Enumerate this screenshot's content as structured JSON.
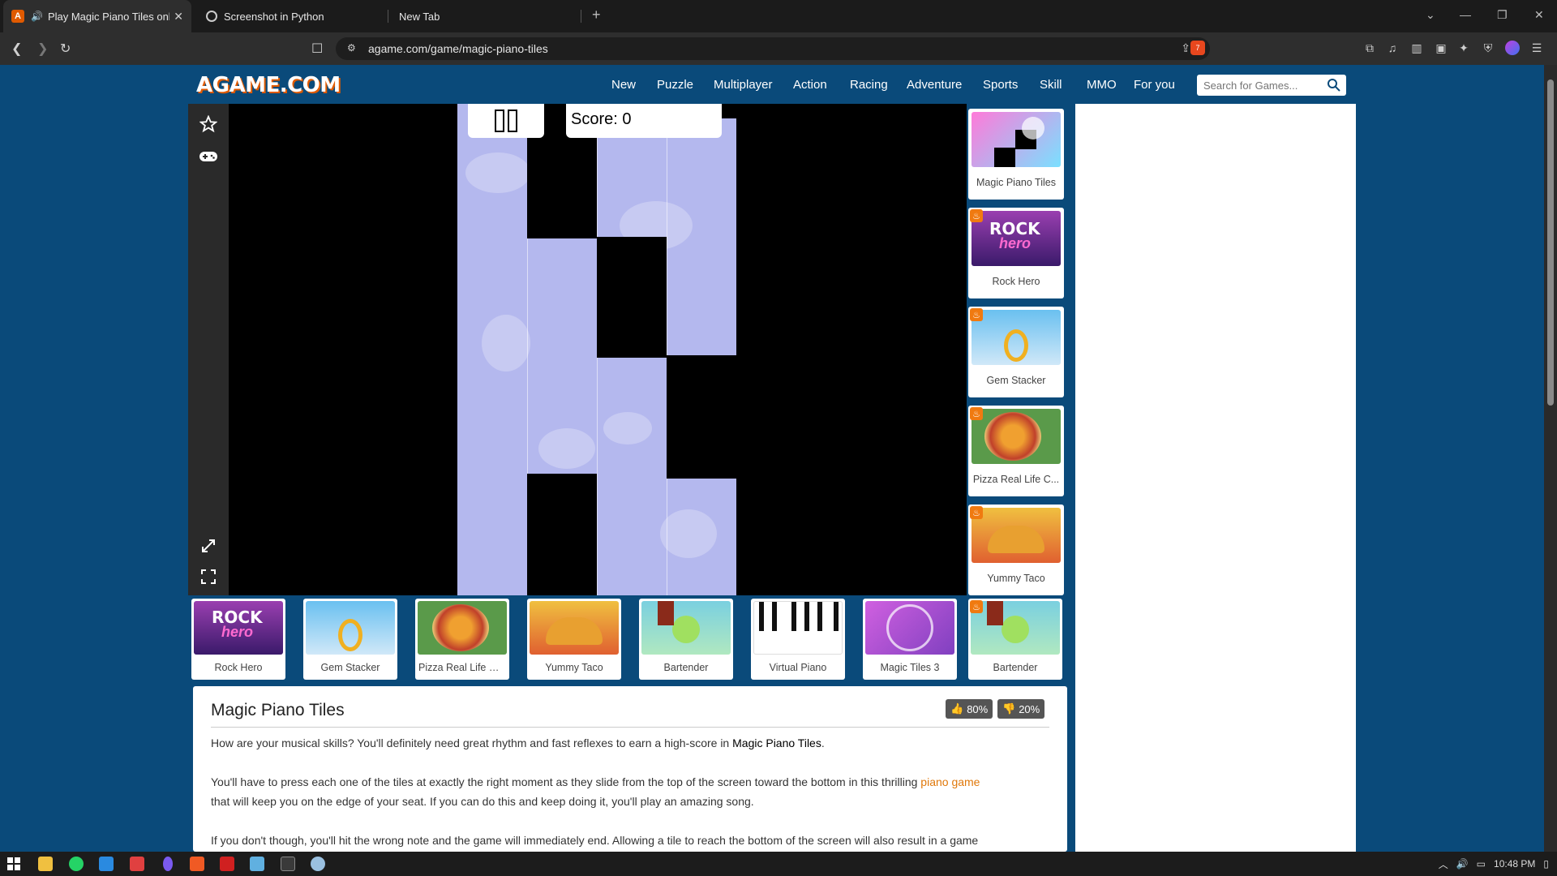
{
  "browser": {
    "tabs": [
      {
        "title": "Play Magic Piano Tiles onlin",
        "active": true
      },
      {
        "title": "Screenshot in Python",
        "active": false
      },
      {
        "title": "New Tab",
        "active": false
      }
    ],
    "url": "agame.com/game/magic-piano-tiles",
    "shield_badge": "7"
  },
  "site": {
    "logo": "AGAME.COM",
    "nav": [
      "New",
      "Puzzle",
      "Multiplayer",
      "Action",
      "Racing",
      "Adventure",
      "Sports",
      "Skill",
      "MMO",
      "For you"
    ],
    "search_placeholder": "Search for Games..."
  },
  "game": {
    "score_label": "Score: 0"
  },
  "side_games": [
    "Magic Piano Tiles",
    "Rock Hero",
    "Gem Stacker",
    "Pizza Real Life C...",
    "Yummy Taco"
  ],
  "bottom_games": [
    "Rock Hero",
    "Gem Stacker",
    "Pizza Real Life Co...",
    "Yummy Taco",
    "Bartender",
    "Virtual Piano",
    "Magic Tiles 3",
    "Bartender"
  ],
  "description": {
    "title": "Magic Piano Tiles",
    "likes": "80%",
    "dislikes": "20%",
    "p1_a": "How are your musical skills? You'll definitely need great rhythm and fast reflexes to earn a high-score in ",
    "p1_bold": "Magic Piano Tiles",
    "p1_b": ".",
    "p2_a": "You'll have to press each one of the tiles at exactly the right moment as they slide from the top of the screen toward the bottom in this thrilling ",
    "p2_link": "piano game",
    "p2_b": "that will keep you on the edge of your seat. If you can do this and keep doing it, you'll play an amazing song.",
    "p3": "If you don't though, you'll hit the wrong note and the game will immediately end. Allowing a tile to reach the bottom of the screen will also result in a game"
  },
  "taskbar": {
    "time": "10:48 PM"
  }
}
